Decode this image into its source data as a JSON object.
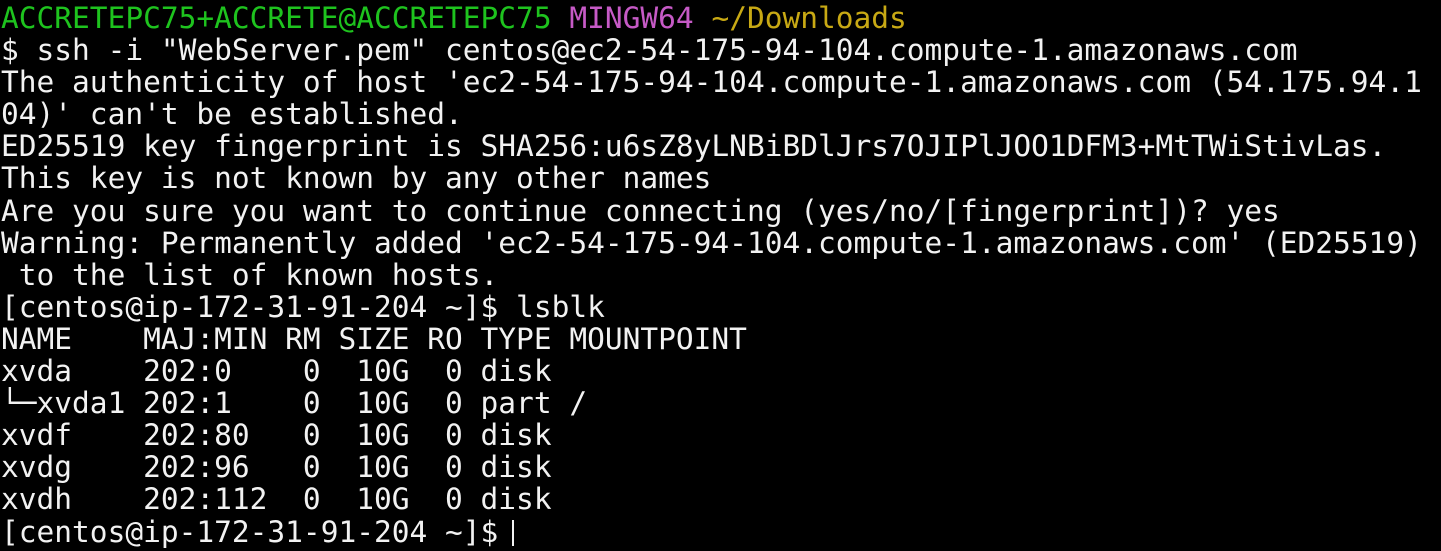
{
  "prompt": {
    "user_host": "ACCRETEPC75+ACCRETE@ACCRETEPC75",
    "msystem": "MINGW64",
    "cwd": "~/Downloads"
  },
  "lines": [
    "$ ssh -i \"WebServer.pem\" centos@ec2-54-175-94-104.compute-1.amazonaws.com",
    "The authenticity of host 'ec2-54-175-94-104.compute-1.amazonaws.com (54.175.94.1",
    "04)' can't be established.",
    "ED25519 key fingerprint is SHA256:u6sZ8yLNBiBDlJrs7OJIPlJOO1DFM3+MtTWiStivLas.",
    "This key is not known by any other names",
    "Are you sure you want to continue connecting (yes/no/[fingerprint])? yes",
    "Warning: Permanently added 'ec2-54-175-94-104.compute-1.amazonaws.com' (ED25519)",
    " to the list of known hosts.",
    "[centos@ip-172-31-91-204 ~]$ lsblk",
    "NAME    MAJ:MIN RM SIZE RO TYPE MOUNTPOINT",
    "xvda    202:0    0  10G  0 disk",
    "└─xvda1 202:1    0  10G  0 part /",
    "xvdf    202:80   0  10G  0 disk",
    "xvdg    202:96   0  10G  0 disk",
    "xvdh    202:112  0  10G  0 disk"
  ],
  "final_prompt": "[centos@ip-172-31-91-204 ~]$",
  "colors": {
    "background": "#000000",
    "foreground": "#f2f2f2",
    "user_host": "#1ec31e",
    "msystem": "#c65ac6",
    "cwd": "#c8a914"
  }
}
